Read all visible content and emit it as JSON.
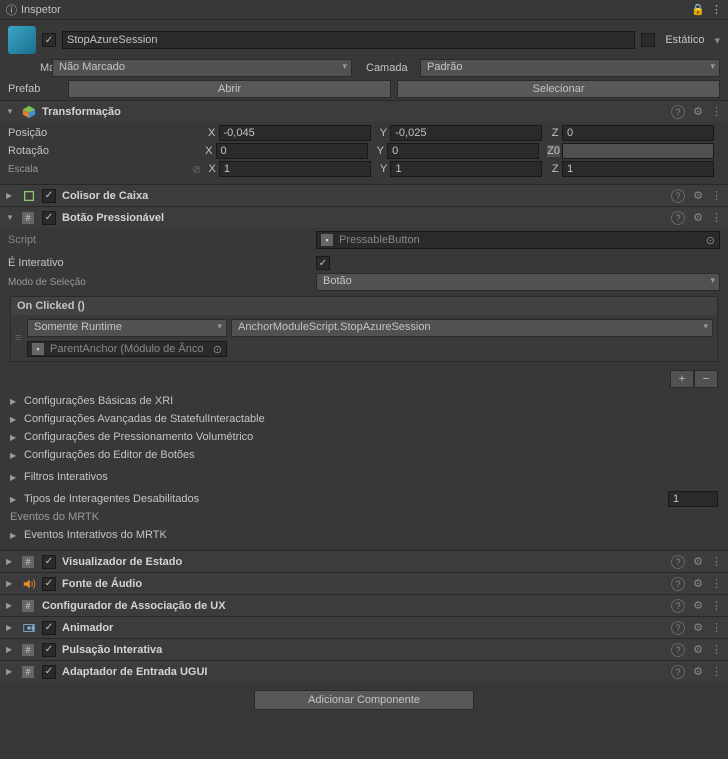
{
  "tab": {
    "title": "Inspetor"
  },
  "gameobject": {
    "enabled": true,
    "name": "StopAzureSession",
    "static_label": "Estático",
    "tag_label": "Marca",
    "tag_value": "Não Marcado",
    "layer_label": "Camada",
    "layer_value": "Padrão",
    "prefab_label": "Prefab",
    "open_btn": "Abrir",
    "select_btn": "Selecionar"
  },
  "transform": {
    "title": "Transformação",
    "position_label": "Posição",
    "rotation_label": "Rotação",
    "scale_label": "Escala",
    "pos": {
      "x": "-0,045",
      "y": "-0,025",
      "z": "0"
    },
    "rot": {
      "x": "0",
      "y": "0",
      "z": "0",
      "zlabel": "Z0"
    },
    "scale": {
      "x": "1",
      "y": "1",
      "z": "1"
    }
  },
  "box_collider": {
    "title": "Colisor de Caixa"
  },
  "pressable_button": {
    "title": "Botão Pressionável",
    "script_label": "Script",
    "script_value": "PressableButton",
    "interactive_label": "É Interativo",
    "selectmode_label": "Modo de Seleção",
    "selectmode_value": "Botão",
    "onclick_header": "On Clicked ()",
    "runtime_value": "Somente Runtime",
    "function_value": "AnchorModuleScript.StopAzureSession",
    "target_value": "ParentAnchor (Módulo de Ânco",
    "sections": [
      "Configurações Básicas de XRI",
      "Configurações Avançadas de StatefulInteractable",
      "Configurações de Pressionamento Volumétrico",
      "Configurações do Editor de Botões"
    ],
    "filters": "Filtros Interativos",
    "disabled_types": "Tipos de Interagentes Desabilitados",
    "disabled_count": "1",
    "mrtk_events": "Eventos do MRTK",
    "mrtk_interactive_events": "Eventos Interativos do MRTK"
  },
  "components": [
    {
      "title": "Visualizador de Estado",
      "icon": "script",
      "checked": true
    },
    {
      "title": "Fonte de Áudio",
      "icon": "audio",
      "checked": true
    },
    {
      "title": "Configurador de Associação de UX",
      "icon": "script",
      "checked": false
    },
    {
      "title": "Animador",
      "icon": "anim",
      "checked": true
    },
    {
      "title": "Pulsação Interativa",
      "icon": "script",
      "checked": true
    },
    {
      "title": "Adaptador de Entrada UGUI",
      "icon": "script",
      "checked": true
    }
  ],
  "add_component_btn": "Adicionar Componente"
}
